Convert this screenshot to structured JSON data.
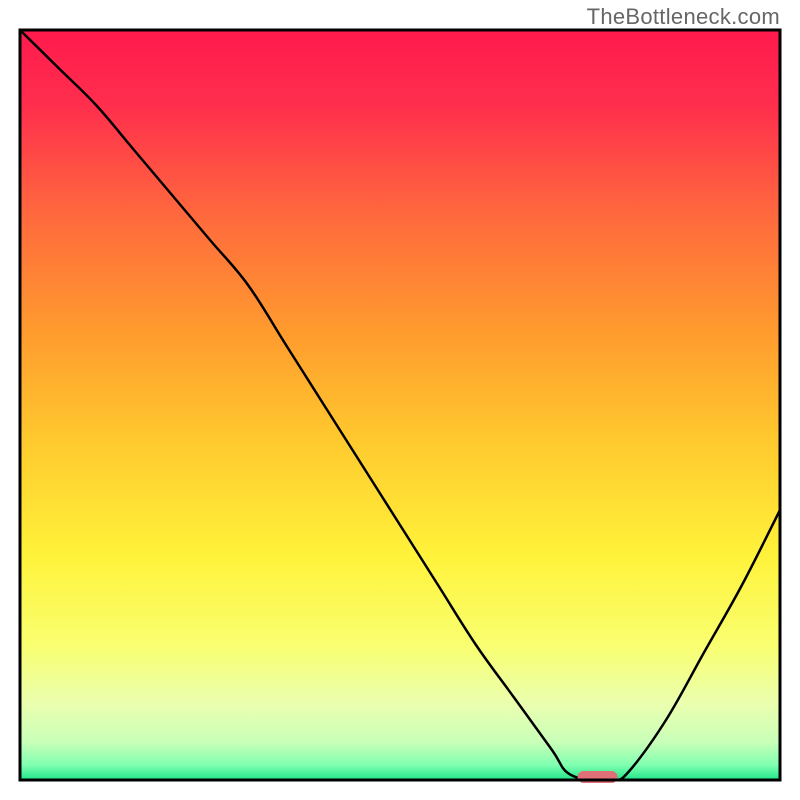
{
  "watermark": "TheBottleneck.com",
  "chart_data": {
    "type": "line",
    "title": "",
    "xlabel": "",
    "ylabel": "",
    "xlim": [
      0,
      100
    ],
    "ylim": [
      0,
      100
    ],
    "x": [
      0,
      5,
      10,
      15,
      20,
      25,
      30,
      35,
      40,
      45,
      50,
      55,
      60,
      65,
      70,
      72,
      75,
      78,
      80,
      85,
      90,
      95,
      100
    ],
    "values": [
      100,
      95,
      90,
      84,
      78,
      72,
      66,
      58,
      50,
      42,
      34,
      26,
      18,
      11,
      4,
      1,
      0,
      0,
      1,
      8,
      17,
      26,
      36
    ],
    "marker": {
      "x_center": 76,
      "y_value": 0.4,
      "color": "#e07078",
      "shape": "pill"
    },
    "background_gradient": {
      "type": "vertical",
      "stops": [
        {
          "pos": 0.0,
          "color": "#ff1a4d"
        },
        {
          "pos": 0.1,
          "color": "#ff2e4d"
        },
        {
          "pos": 0.25,
          "color": "#ff6a3d"
        },
        {
          "pos": 0.4,
          "color": "#ff9a2e"
        },
        {
          "pos": 0.55,
          "color": "#ffca2e"
        },
        {
          "pos": 0.7,
          "color": "#fff23a"
        },
        {
          "pos": 0.82,
          "color": "#f9ff70"
        },
        {
          "pos": 0.9,
          "color": "#eaffb0"
        },
        {
          "pos": 0.95,
          "color": "#c8ffb8"
        },
        {
          "pos": 0.98,
          "color": "#80ffb0"
        },
        {
          "pos": 1.0,
          "color": "#1fe58a"
        }
      ]
    },
    "annotations": [],
    "grid": false,
    "legend": null
  },
  "plot": {
    "margin_left": 20,
    "margin_right": 20,
    "margin_top": 30,
    "margin_bottom": 20,
    "frame_color": "#000000",
    "frame_width": 3,
    "curve_color": "#000000",
    "curve_width": 2.5
  }
}
